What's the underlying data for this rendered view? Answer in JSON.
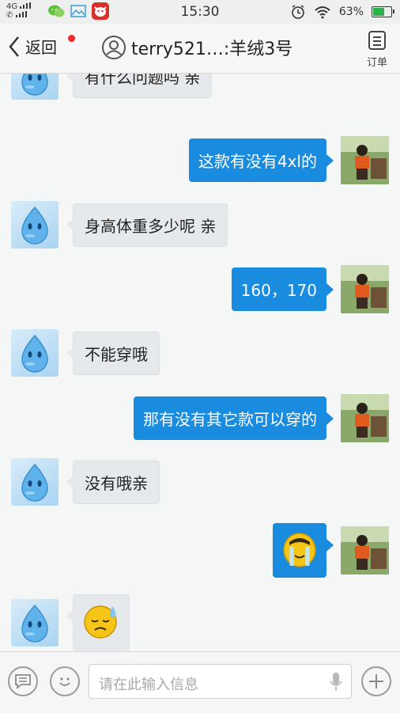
{
  "status_bar": {
    "network": "4G",
    "time": "15:30",
    "battery_percent": "63%",
    "battery_level": 0.63
  },
  "header": {
    "back_label": "返回",
    "title": "terry521…:羊绒3号",
    "order_label": "订单"
  },
  "messages": [
    {
      "side": "left",
      "type": "text",
      "text": "有什么问题吗 亲"
    },
    {
      "side": "right",
      "type": "text",
      "text": "这款有没有4xl的"
    },
    {
      "side": "left",
      "type": "text",
      "text": "身高体重多少呢 亲"
    },
    {
      "side": "right",
      "type": "text",
      "text": "160，170"
    },
    {
      "side": "left",
      "type": "text",
      "text": "不能穿哦"
    },
    {
      "side": "right",
      "type": "text",
      "text": "那有没有其它款可以穿的"
    },
    {
      "side": "left",
      "type": "text",
      "text": "没有哦亲"
    },
    {
      "side": "right",
      "type": "emoji",
      "emoji": "crying-face"
    },
    {
      "side": "left",
      "type": "emoji",
      "emoji": "sweating-face"
    }
  ],
  "input_bar": {
    "placeholder": "请在此输入信息"
  },
  "colors": {
    "right_bubble": "#1a8ce0",
    "left_bubble": "#e6e9ec",
    "unread_dot": "#ef2a2a"
  }
}
